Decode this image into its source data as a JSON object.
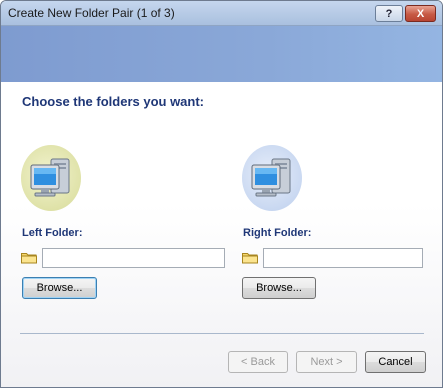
{
  "window": {
    "title": "Create New Folder Pair (1 of 3)",
    "help_button": "?",
    "close_button": "X"
  },
  "main": {
    "heading": "Choose the folders you want:",
    "left": {
      "label": "Left Folder:",
      "path_value": "",
      "browse_label": "Browse..."
    },
    "right": {
      "label": "Right Folder:",
      "path_value": "",
      "browse_label": "Browse..."
    }
  },
  "footer": {
    "back_label": "< Back",
    "next_label": "Next >",
    "cancel_label": "Cancel",
    "back_enabled": false,
    "next_enabled": false
  },
  "icons": {
    "left_computer": "computer-icon",
    "right_computer": "computer-icon",
    "folder": "folder-icon"
  },
  "colors": {
    "banner": "#8aa8d8",
    "heading_text": "#1f3777",
    "left_bubble": "#dfe2a8",
    "right_bubble": "#c9d8f1",
    "focus_border": "#3c7fb1"
  }
}
